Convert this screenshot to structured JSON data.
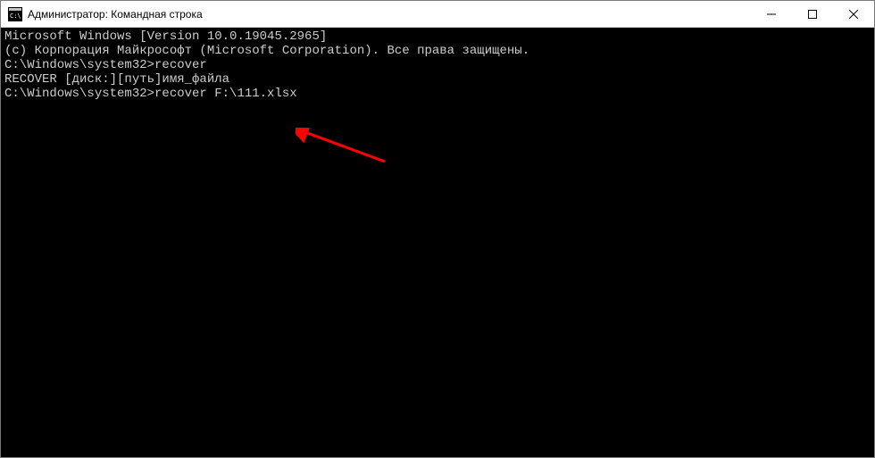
{
  "titlebar": {
    "title": "Администратор: Командная строка"
  },
  "terminal": {
    "lines": [
      "Microsoft Windows [Version 10.0.19045.2965]",
      "(c) Корпорация Майкрософт (Microsoft Corporation). Все права защищены.",
      "",
      "C:\\Windows\\system32>recover",
      "RECOVER [диск:][путь]имя_файла",
      "",
      "C:\\Windows\\system32>recover F:\\111.xlsx"
    ]
  }
}
